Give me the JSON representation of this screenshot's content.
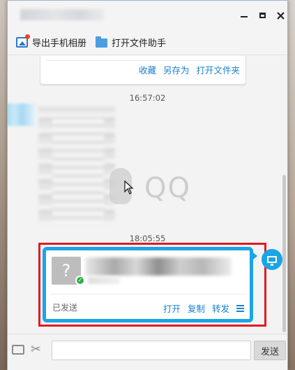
{
  "toolbar": {
    "export_album_label": "导出手机相册",
    "file_helper_label": "打开文件助手"
  },
  "chat": {
    "prev_file_card": {
      "actions": [
        "收藏",
        "另存为",
        "打开文件夹"
      ]
    },
    "timestamp_1": "16:57:02",
    "qq_watermark": "QQ",
    "timestamp_2": "18:05:55",
    "sent_file_card": {
      "thumb_glyph": "?",
      "status": "已发送",
      "actions": [
        "打开",
        "复制",
        "转发"
      ]
    }
  },
  "inputbar": {
    "send_label": "发送"
  },
  "colors": {
    "accent_blue": "#1ba4e6",
    "link_blue": "#1a7fd0",
    "highlight_red": "#e21a23",
    "success_green": "#2fb14a"
  }
}
